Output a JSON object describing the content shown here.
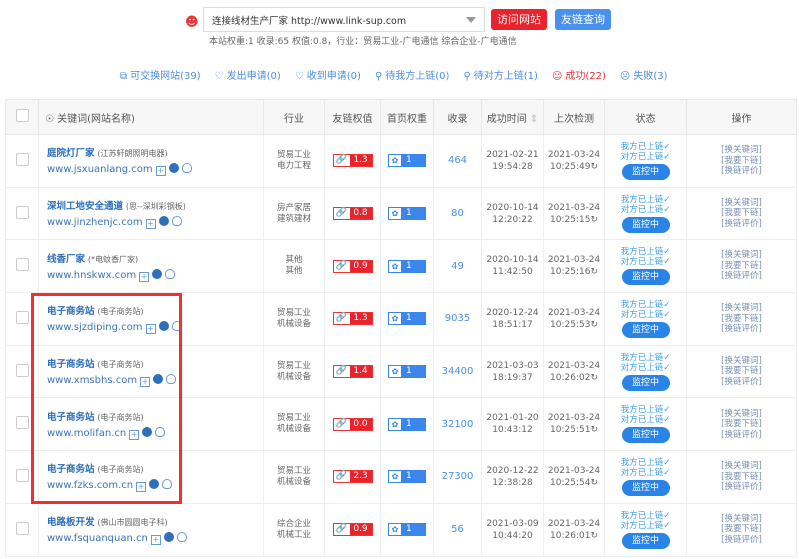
{
  "header": {
    "site_select": "连接线材生产厂家 http://www.link-sup.com",
    "visit_button": "访问网站",
    "query_button": "友链查询",
    "meta": "本站权重:1 收录:65 权值:0.8，行业：贸易工业-广电通信 综合企业-广电通信"
  },
  "tabs": [
    {
      "icon": "exchange-icon",
      "label": "可交换网站(39)"
    },
    {
      "icon": "heart-icon",
      "label": "发出申请(0)"
    },
    {
      "icon": "heart-icon",
      "label": "收到申请(0)"
    },
    {
      "icon": "person-link-icon",
      "label": "待我方上链(0)"
    },
    {
      "icon": "person-link-icon",
      "label": "待对方上链(1)"
    },
    {
      "icon": "smile-icon",
      "label": "成功(22)"
    },
    {
      "icon": "sad-icon",
      "label": "失败(3)"
    }
  ],
  "columns": [
    "关键词(网站名称)",
    "行业",
    "友链权值",
    "首页权重",
    "收录",
    "成功时间",
    "上次检测",
    "状态",
    "操作"
  ],
  "status_labels": {
    "mine": "我方已上链✓",
    "theirs": "对方已上链✓",
    "monitor": "监控中"
  },
  "ops": [
    "[换关键词]",
    "[我要下链]",
    "[换链评价]"
  ],
  "rows": [
    {
      "keyword": "庭院灯厂家",
      "name": "(江苏轩朗照明电器)",
      "url": "www.jsxuanlang.com",
      "ind1": "贸易工业",
      "ind2": "电力工程",
      "link_weight": "1.3",
      "home_weight": "1",
      "indexed": "464",
      "success_date": "2021-02-21",
      "success_time": "19:54:28",
      "check_date": "2021-03-24",
      "check_time": "10:25:49"
    },
    {
      "keyword": "深圳工地安全通道",
      "name": "(思--深圳彩钢板)",
      "url": "www.jinzhenjc.com",
      "ind1": "房产家居",
      "ind2": "建筑建材",
      "link_weight": "0.8",
      "home_weight": "1",
      "indexed": "80",
      "success_date": "2020-10-14",
      "success_time": "12:20:22",
      "check_date": "2021-03-24",
      "check_time": "10:25:15"
    },
    {
      "keyword": "线香厂家",
      "name": "(*电蚊香厂家)",
      "url": "www.hnskwx.com",
      "ind1": "其他",
      "ind2": "其他",
      "link_weight": "0.9",
      "home_weight": "1",
      "indexed": "49",
      "success_date": "2020-10-14",
      "success_time": "11:42:50",
      "check_date": "2021-03-24",
      "check_time": "10:25:16"
    },
    {
      "keyword": "电子商务站",
      "name": "(电子商务站)",
      "url": "www.sjzdiping.com",
      "ind1": "贸易工业",
      "ind2": "机械设备",
      "link_weight": "1.3",
      "home_weight": "1",
      "indexed": "9035",
      "success_date": "2020-12-24",
      "success_time": "18:51:17",
      "check_date": "2021-03-24",
      "check_time": "10:25:53"
    },
    {
      "keyword": "电子商务站",
      "name": "(电子商务站)",
      "url": "www.xmsbhs.com",
      "ind1": "贸易工业",
      "ind2": "机械设备",
      "link_weight": "1.4",
      "home_weight": "1",
      "indexed": "34400",
      "success_date": "2021-03-03",
      "success_time": "18:19:37",
      "check_date": "2021-03-24",
      "check_time": "10:26:02"
    },
    {
      "keyword": "电子商务站",
      "name": "(电子商务站)",
      "url": "www.molifan.cn",
      "ind1": "贸易工业",
      "ind2": "机械设备",
      "link_weight": "0.0",
      "home_weight": "1",
      "indexed": "32100",
      "success_date": "2021-01-20",
      "success_time": "10:43:12",
      "check_date": "2021-03-24",
      "check_time": "10:25:51"
    },
    {
      "keyword": "电子商务站",
      "name": "(电子商务站)",
      "url": "www.fzks.com.cn",
      "ind1": "贸易工业",
      "ind2": "机械设备",
      "link_weight": "2.3",
      "home_weight": "1",
      "indexed": "27300",
      "success_date": "2020-12-22",
      "success_time": "12:38:28",
      "check_date": "2021-03-24",
      "check_time": "10:25:54"
    },
    {
      "keyword": "电路板开发",
      "name": "(佛山市圆圆电子科)",
      "url": "www.fsquanquan.cn",
      "ind1": "综合企业",
      "ind2": "机械工业",
      "link_weight": "0.9",
      "home_weight": "1",
      "indexed": "56",
      "success_date": "2021-03-09",
      "success_time": "10:44:20",
      "check_date": "2021-03-24",
      "check_time": "10:26:01"
    }
  ]
}
